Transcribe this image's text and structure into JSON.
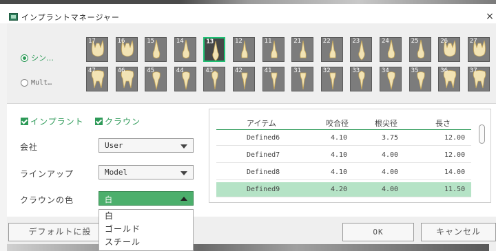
{
  "window": {
    "title": "インプラントマネージャー",
    "close_glyph": "×"
  },
  "radios": [
    {
      "label": "シン…",
      "checked": true
    },
    {
      "label": "Mult…",
      "checked": false
    }
  ],
  "teeth": {
    "upper": [
      {
        "number": "17",
        "type": "molar"
      },
      {
        "number": "16",
        "type": "molar"
      },
      {
        "number": "15",
        "type": "premolar"
      },
      {
        "number": "14",
        "type": "premolar"
      },
      {
        "number": "13",
        "type": "canine",
        "selected": true
      },
      {
        "number": "12",
        "type": "incisor"
      },
      {
        "number": "11",
        "type": "incisor"
      },
      {
        "number": "21",
        "type": "incisor"
      },
      {
        "number": "22",
        "type": "incisor"
      },
      {
        "number": "23",
        "type": "canine"
      },
      {
        "number": "24",
        "type": "premolar"
      },
      {
        "number": "25",
        "type": "premolar"
      },
      {
        "number": "26",
        "type": "molar"
      },
      {
        "number": "27",
        "type": "molar"
      }
    ],
    "lower": [
      {
        "number": "47",
        "type": "molar"
      },
      {
        "number": "46",
        "type": "molar"
      },
      {
        "number": "45",
        "type": "premolar"
      },
      {
        "number": "44",
        "type": "premolar"
      },
      {
        "number": "43",
        "type": "canine"
      },
      {
        "number": "42",
        "type": "incisor"
      },
      {
        "number": "41",
        "type": "incisor"
      },
      {
        "number": "31",
        "type": "incisor"
      },
      {
        "number": "32",
        "type": "incisor"
      },
      {
        "number": "33",
        "type": "canine"
      },
      {
        "number": "34",
        "type": "premolar"
      },
      {
        "number": "35",
        "type": "premolar"
      },
      {
        "number": "36",
        "type": "molar"
      },
      {
        "number": "37",
        "type": "molar"
      }
    ]
  },
  "checks": {
    "implant": "インプラント",
    "crown": "クラウン"
  },
  "form": {
    "company_label": "会社",
    "company_value": "User",
    "lineup_label": "ラインアップ",
    "lineup_value": "Model",
    "crown_color_label": "クラウンの色",
    "crown_color_value": "白"
  },
  "table": {
    "headers": [
      "アイテム",
      "咬合径",
      "根尖径",
      "長さ"
    ],
    "rows": [
      [
        "Defined6",
        "4.10",
        "3.75",
        "12.00"
      ],
      [
        "Defined7",
        "4.10",
        "4.00",
        "12.00"
      ],
      [
        "Defined8",
        "4.10",
        "4.00",
        "14.00"
      ],
      [
        "Defined9",
        "4.20",
        "4.00",
        "11.50"
      ]
    ],
    "selected_row": 3
  },
  "buttons": {
    "default": "デフォルトに設",
    "ok": "OK",
    "cancel": "キャンセル"
  },
  "dropdown_options": [
    "白",
    "ゴールド",
    "スチール"
  ],
  "colors": {
    "accent": "#2e9a58",
    "selected_row": "#b5e3c6",
    "open_select": "#4caf6c"
  }
}
